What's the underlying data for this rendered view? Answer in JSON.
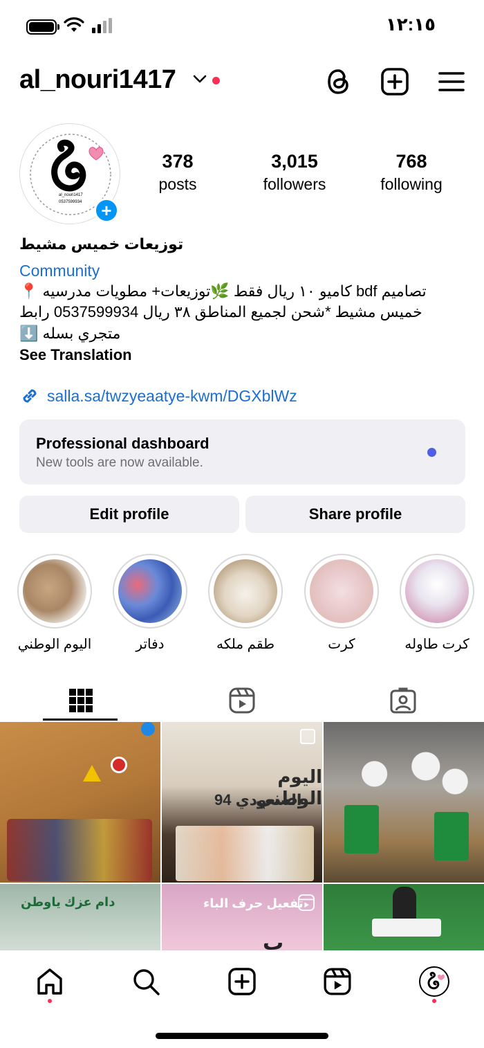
{
  "status_bar": {
    "time": "١٢:١٥"
  },
  "header": {
    "username": "al_nouri1417",
    "threads_icon": "threads-icon",
    "create_icon": "plus-square-icon",
    "menu_icon": "hamburger-menu-icon"
  },
  "profile": {
    "logo_handle": "al_nouri1417",
    "logo_phone": "0537599934",
    "stats": [
      {
        "value": "378",
        "label": "posts"
      },
      {
        "value": "3,015",
        "label": "followers"
      },
      {
        "value": "768",
        "label": "following"
      }
    ]
  },
  "bio": {
    "name": "توزيعات خميس مشيط",
    "category": "Community",
    "lines": [
      "تصاميم bdf كاميو ١٠ ريال فقط 🌿توزيعات+ مطويات مدرسيه 📍",
      "خميس مشيط *شحن لجميع المناطق ٣٨ ريال 0537599934 رابط",
      "متجري بسله ⬇️"
    ],
    "see_translation": "See Translation",
    "link": "salla.sa/twzyeaatye-kwm/DGXblWz"
  },
  "dashboard": {
    "title": "Professional dashboard",
    "subtitle": "New tools are now available."
  },
  "buttons": {
    "edit": "Edit profile",
    "share": "Share profile"
  },
  "highlights": [
    {
      "label": "اليوم الوطني"
    },
    {
      "label": "دفاتر"
    },
    {
      "label": "طقم ملكه"
    },
    {
      "label": "كرت"
    },
    {
      "label": "كرت طاوله"
    }
  ],
  "posts": {
    "post2_title": "اليوم الوطني",
    "post2_sub": "السعودي 94",
    "post4_text": "دام عزك ياوطن",
    "post5_text": "تفعيل حرف الباء",
    "post5_letter": "ب"
  },
  "colors": {
    "accent": "#0095f6",
    "link": "#1a6fd0",
    "notification": "#ff2d55"
  }
}
